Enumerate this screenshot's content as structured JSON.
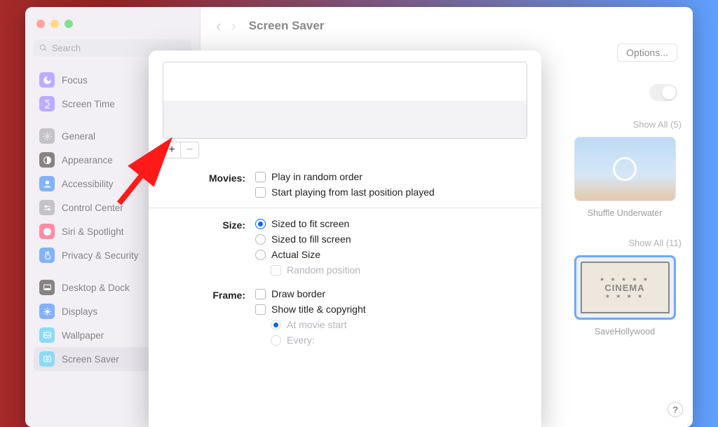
{
  "window": {
    "title": "Screen Saver",
    "search_placeholder": "Search"
  },
  "sidebar": {
    "items": [
      {
        "label": "Focus",
        "icon": "moon",
        "color": "#8e6fff"
      },
      {
        "label": "Screen Time",
        "icon": "hourglass",
        "color": "#8e6fff"
      },
      {
        "label": "General",
        "icon": "gear",
        "color": "#9a9aa0"
      },
      {
        "label": "Appearance",
        "icon": "appearance",
        "color": "#2c2c2e"
      },
      {
        "label": "Accessibility",
        "icon": "person",
        "color": "#2a7af5"
      },
      {
        "label": "Control Center",
        "icon": "switches",
        "color": "#9a9aa0"
      },
      {
        "label": "Siri & Spotlight",
        "icon": "siri",
        "color": "#ff3a64"
      },
      {
        "label": "Privacy & Security",
        "icon": "hand",
        "color": "#2a7af5"
      },
      {
        "label": "Desktop & Dock",
        "icon": "dock",
        "color": "#2c2c2e"
      },
      {
        "label": "Displays",
        "icon": "sun",
        "color": "#2a7af5"
      },
      {
        "label": "Wallpaper",
        "icon": "wallpaper",
        "color": "#3cbff0"
      },
      {
        "label": "Screen Saver",
        "icon": "saver",
        "color": "#3cbff0",
        "active": true
      }
    ]
  },
  "main": {
    "options_button": "Options...",
    "show_all_1": "Show All (5)",
    "thumb1_label": "Shuffle Underwater",
    "show_all_2": "Show All (11)",
    "thumb2_label": "SaveHollywood",
    "cinema_word": "CINEMA"
  },
  "modal": {
    "movies_label": "Movies:",
    "movies_random": "Play in random order",
    "movies_resume": "Start playing from last position played",
    "size_label": "Size:",
    "size_fit": "Sized to fit screen",
    "size_fill": "Sized to fill screen",
    "size_actual": "Actual Size",
    "size_random_pos": "Random position",
    "frame_label": "Frame:",
    "frame_border": "Draw border",
    "frame_title": "Show title & copyright",
    "frame_at_start": "At movie start",
    "frame_every": "Every:"
  }
}
